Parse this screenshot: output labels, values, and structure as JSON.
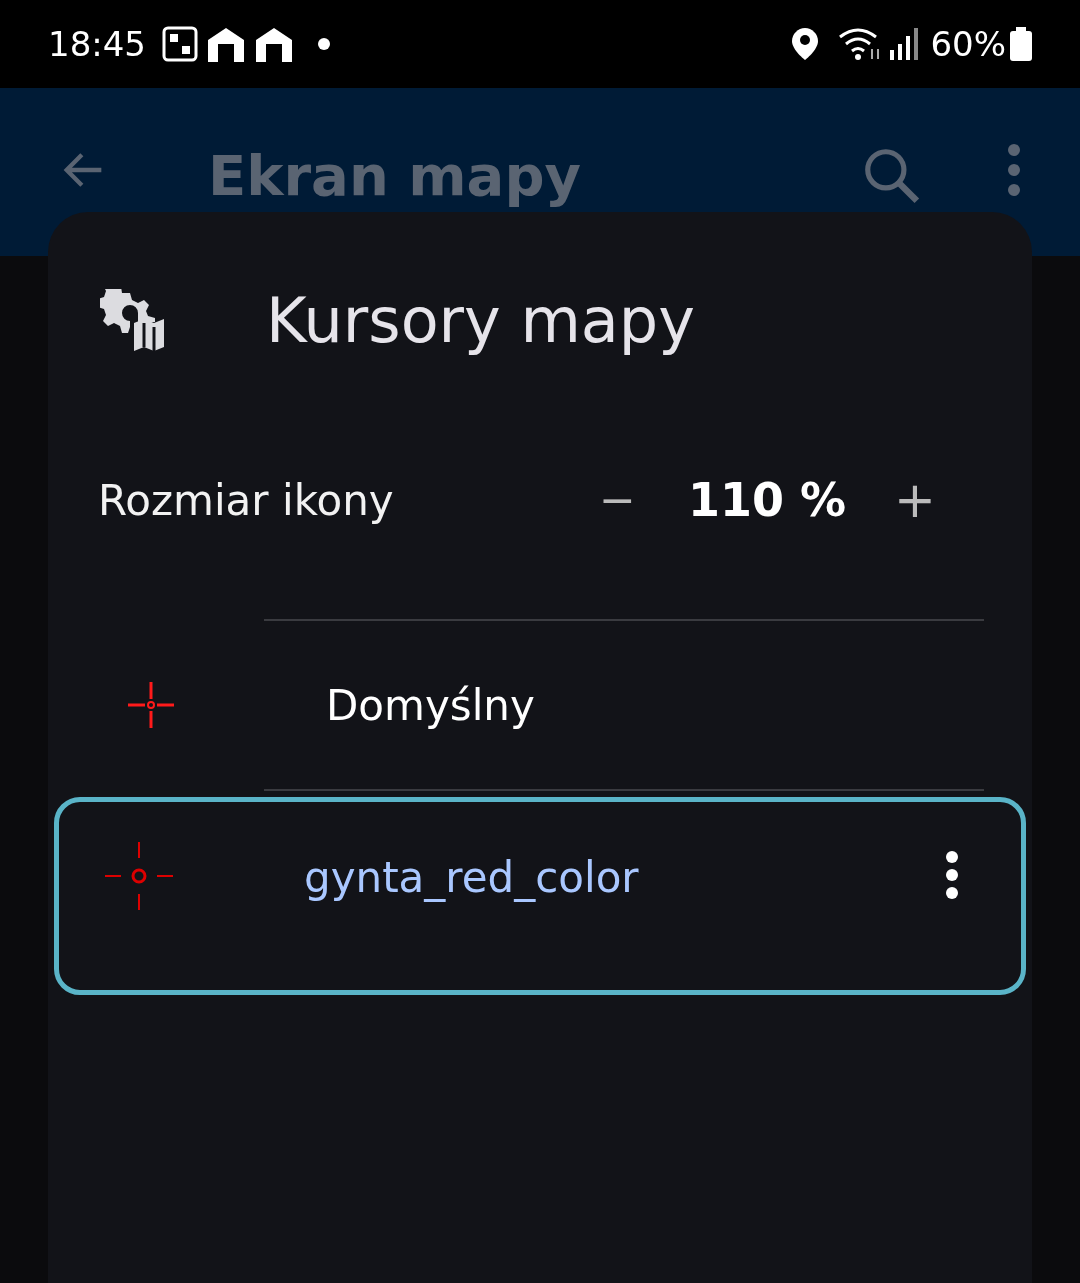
{
  "status_bar": {
    "time": "18:45",
    "battery": "60%"
  },
  "app_bar": {
    "title": "Ekran mapy"
  },
  "dialog": {
    "title": "Kursory mapy",
    "size": {
      "label": "Rozmiar ikony",
      "minus": "−",
      "value": "110 %",
      "plus": "+"
    },
    "cursors": [
      {
        "name": "Domyślny",
        "kind": "cross",
        "selected": false
      },
      {
        "name": "gynta_red_color",
        "kind": "ring",
        "selected": true
      }
    ]
  }
}
